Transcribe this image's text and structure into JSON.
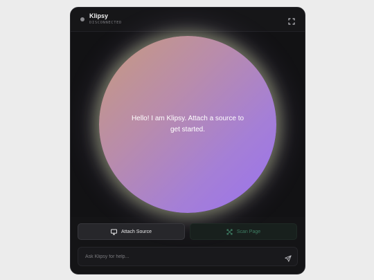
{
  "header": {
    "title": "Klipsy",
    "status": "DISCONNECTED"
  },
  "orb": {
    "message": "Hello! I am Klipsy. Attach a source to get started."
  },
  "actions": {
    "attach_label": "Attach Source",
    "scan_label": "Scan Page"
  },
  "input": {
    "placeholder": "Ask Klipsy for help..."
  },
  "icons": {
    "expand": "expand-icon",
    "attach": "monitor-icon",
    "scan": "scan-icon",
    "send": "send-icon"
  },
  "colors": {
    "panel_bg": "#141416",
    "orb_start": "#c79a7e",
    "orb_end": "#9a72ee",
    "scan_accent": "#3e7d63",
    "status_dot": "#8a8a8e"
  }
}
